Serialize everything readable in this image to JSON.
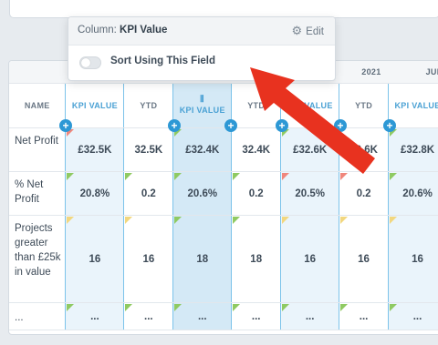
{
  "popover": {
    "title_prefix": "Column:",
    "title_value": "KPI Value",
    "edit_label": "Edit",
    "edit_icon": "gear-icon",
    "sort_label": "Sort Using This Field",
    "sort_enabled": false
  },
  "table": {
    "month_headers": [
      "2021",
      "JUN"
    ],
    "name_header": "NAME",
    "column_headers": [
      "KPI VALUE",
      "YTD",
      "KPI VALUE",
      "YTD",
      "KPI VALUE",
      "YTD",
      "KPI VALUE"
    ],
    "rows": [
      {
        "name": "Net Profit",
        "cells": [
          "£32.5K",
          "32.5K",
          "£32.4K",
          "32.4K",
          "£32.6K",
          "32.6K",
          "£32.8K"
        ]
      },
      {
        "name": "% Net Profit",
        "cells": [
          "20.8%",
          "0.2",
          "20.6%",
          "0.2",
          "20.5%",
          "0.2",
          "20.6%"
        ]
      },
      {
        "name": "Projects greater than £25k in value",
        "cells": [
          "16",
          "16",
          "18",
          "18",
          "16",
          "16",
          "16"
        ]
      },
      {
        "name": "...",
        "cells": [
          "...",
          "...",
          "...",
          "...",
          "...",
          "...",
          "..."
        ]
      }
    ]
  },
  "colors": {
    "kpi_highlight": "#eaf4fb",
    "kpi_selected": "#d4e9f6",
    "kpi_border": "#7cc3ea",
    "add_button": "#2d98d5",
    "arrow": "#e8321f",
    "status_green": "#8fca62",
    "status_red": "#f0877c",
    "status_yellow": "#f2d77f"
  }
}
